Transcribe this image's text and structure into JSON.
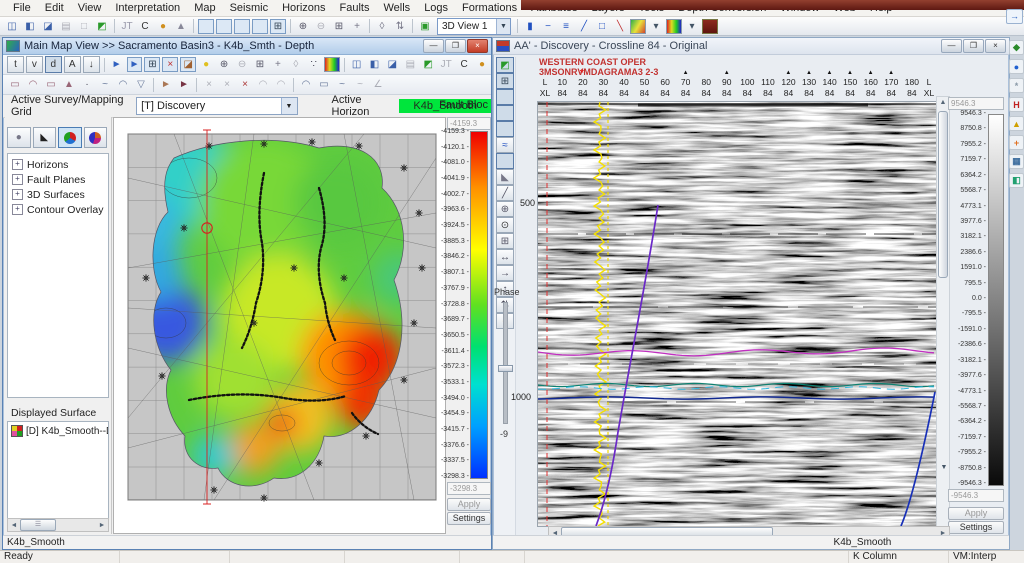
{
  "menu": {
    "items": [
      "File",
      "Edit",
      "View",
      "Interpretation",
      "Map",
      "Seismic",
      "Horizons",
      "Faults",
      "Wells",
      "Logs",
      "Formations",
      "Attributes",
      "Layers",
      "Tools",
      "Depth Conversion",
      "Window",
      "Web",
      "Help"
    ]
  },
  "main_toolbar": {
    "view_selector": "3D View 1",
    "icons": [
      {
        "n": "split-vertical-icon",
        "g": "◫",
        "c": "#3a5fa8"
      },
      {
        "n": "split-horizontal-icon",
        "g": "◧",
        "c": "#3a5fa8"
      },
      {
        "n": "new-window-icon",
        "g": "◪",
        "c": "#3a5fa8"
      },
      {
        "n": "window-gray-icon",
        "g": "▤",
        "d": true
      },
      {
        "n": "window-small-icon",
        "g": "□",
        "d": true
      },
      {
        "n": "map-window-icon",
        "g": "◩",
        "c": "#2a9a2a"
      },
      {
        "s": true
      },
      {
        "n": "jt-button",
        "g": "JT",
        "c": "#99a"
      },
      {
        "n": "c-button",
        "g": "C",
        "c": "#333"
      },
      {
        "n": "well-tools-icon",
        "g": "●",
        "c": "#d09020"
      },
      {
        "n": "flask-icon",
        "g": "▲",
        "c": "#889"
      },
      {
        "s": true
      },
      {
        "n": "inline-view-icon",
        "b": "redblue",
        "p": true
      },
      {
        "n": "crossline-view-icon",
        "b": "redblue",
        "p": true
      },
      {
        "n": "timeslice-view-icon",
        "b": "redblue",
        "p": true
      },
      {
        "n": "arbitrary-line-view-icon",
        "b": "redblue",
        "p": true
      },
      {
        "n": "grid-view-icon",
        "g": "⊞",
        "p": true,
        "c": "#345"
      },
      {
        "s": true
      },
      {
        "n": "zoom-in-icon",
        "g": "⊕",
        "c": "#556"
      },
      {
        "n": "zoom-out-icon",
        "g": "⊖",
        "d": true
      },
      {
        "n": "zoom-extent-icon",
        "g": "⊞",
        "c": "#556"
      },
      {
        "n": "pan-icon",
        "g": "+",
        "c": "#778"
      },
      {
        "s": true
      },
      {
        "n": "lock-icon",
        "g": "◊",
        "c": "#778"
      },
      {
        "n": "sync-scroll-icon",
        "g": "⇅",
        "c": "#778"
      },
      {
        "s": true
      },
      {
        "n": "refresh-view-icon",
        "g": "▣",
        "c": "#2a9a2a"
      },
      {
        "combo": true
      },
      {
        "s": true
      },
      {
        "n": "wiggle-display-icon",
        "g": "▮",
        "c": "#2050c0"
      },
      {
        "n": "line-tool-icon",
        "g": "−",
        "c": "#2050c0"
      },
      {
        "n": "multiline-tool-icon",
        "g": "≡",
        "c": "#2050c0"
      },
      {
        "n": "slope-tool-icon",
        "g": "╱",
        "c": "#2050c0"
      },
      {
        "n": "rectangle-tool-icon",
        "g": "□",
        "c": "#2050c0"
      },
      {
        "n": "fault-segment-tool-icon",
        "g": "╲",
        "c": "#c03030"
      },
      {
        "n": "colormap-icon",
        "b": "map"
      },
      {
        "n": "caret-colormap-icon",
        "g": "▾",
        "c": "#456"
      },
      {
        "n": "palette-icon",
        "b": "palette"
      },
      {
        "n": "caret-palette-icon",
        "g": "▾",
        "c": "#456"
      },
      {
        "n": "maroon-display-icon",
        "b": "maroon"
      }
    ]
  },
  "map_window": {
    "title": "Main Map View >> Sacramento Basin3 - K4b_Smth - Depth",
    "mode_buttons": [
      "t",
      "v",
      "d",
      "A",
      "↓"
    ],
    "toolbar_icons": [
      {
        "n": "select-arrow-icon",
        "g": "►",
        "c": "#3060c0"
      },
      {
        "n": "select-wave-icon",
        "g": "►",
        "c": "#3060c0",
        "p": true
      },
      {
        "n": "grid-select-icon",
        "g": "⊞",
        "c": "#345",
        "p": true
      },
      {
        "n": "delete-grid-icon",
        "g": "×",
        "c": "#c03030",
        "p": true
      },
      {
        "n": "eraser-icon",
        "g": "◪",
        "c": "#a06030",
        "p": true
      },
      {
        "n": "bubble-icon",
        "g": "●",
        "c": "#e0c020"
      },
      {
        "n": "zoom-in-icon",
        "g": "⊕",
        "c": "#556"
      },
      {
        "n": "zoom-out-icon",
        "g": "⊖",
        "d": true
      },
      {
        "n": "zoom-grid-icon",
        "g": "⊞",
        "c": "#556"
      },
      {
        "n": "pan-icon",
        "g": "+",
        "c": "#778"
      },
      {
        "n": "undo-icon",
        "g": "◊",
        "d": true
      },
      {
        "n": "posting-icon",
        "g": "∵",
        "c": "#445"
      },
      {
        "n": "tricolor-map-icon",
        "b": "palette"
      },
      {
        "s": true
      },
      {
        "n": "split-vertical-icon",
        "g": "◫",
        "c": "#3a5fa8"
      },
      {
        "n": "split-horizontal-icon",
        "g": "◧",
        "c": "#3a5fa8"
      },
      {
        "n": "new-window-icon",
        "g": "◪",
        "c": "#3a5fa8"
      },
      {
        "n": "window-gray-icon",
        "g": "▤",
        "d": true
      },
      {
        "n": "map-window-icon",
        "g": "◩",
        "c": "#2a9a2a"
      },
      {
        "n": "jt-button",
        "g": "JT",
        "d": true
      },
      {
        "n": "c-button",
        "g": "C",
        "c": "#333"
      },
      {
        "n": "well-tools-icon",
        "g": "●",
        "c": "#d09020"
      }
    ],
    "edit_toolbar_icons": [
      {
        "n": "contour-rect-icon",
        "g": "▭",
        "c": "#967"
      },
      {
        "n": "contour-arc-icon",
        "g": "◠",
        "c": "#967"
      },
      {
        "n": "contour-flat-icon",
        "g": "▭",
        "c": "#967"
      },
      {
        "n": "peak-pick-icon",
        "g": "▲",
        "c": "#967"
      },
      {
        "n": "point-pick-icon",
        "g": "·",
        "c": "#445"
      },
      {
        "n": "smooth-pick-icon",
        "g": "~",
        "c": "#679"
      },
      {
        "n": "arc-pick-icon",
        "g": "◠",
        "c": "#679"
      },
      {
        "n": "trough-pick-icon",
        "g": "▽",
        "c": "#679"
      },
      {
        "s": true
      },
      {
        "n": "snap-right-icon",
        "g": "►",
        "c": "#a75"
      },
      {
        "n": "snap-strong-icon",
        "g": "►",
        "c": "#734"
      },
      {
        "s": true
      },
      {
        "n": "erase-pick-icon",
        "g": "×",
        "d": true
      },
      {
        "n": "erase-area-icon",
        "g": "×",
        "d": true
      },
      {
        "n": "erase-all-icon",
        "g": "×",
        "c": "#a33"
      },
      {
        "n": "interp-arc-icon",
        "g": "◠",
        "d": true
      },
      {
        "n": "interp-arc2-icon",
        "g": "◠",
        "d": true
      },
      {
        "s": true
      },
      {
        "n": "extend-arc-icon",
        "g": "◠",
        "c": "#679"
      },
      {
        "n": "extend-flat-icon",
        "g": "▭",
        "c": "#679"
      },
      {
        "n": "wave-smooth-icon",
        "g": "~",
        "c": "#679"
      },
      {
        "n": "wave-smooth2-icon",
        "g": "~",
        "d": true
      },
      {
        "n": "angle-pick-icon",
        "g": "∠",
        "d": true
      }
    ],
    "controls": {
      "survey_label": "Active Survey/Mapping Grid",
      "survey_value": "[T] Discovery",
      "horizon_label": "Active Horizon",
      "horizon_value": "K4b_Smooth",
      "fault_label": "Fault Bloc"
    },
    "tree_items": [
      "Horizons",
      "Fault Planes",
      "3D Surfaces",
      "Contour Overlay"
    ],
    "displayed_surface": {
      "label": "Displayed Surface",
      "item": "[D] K4b_Smooth--Di..."
    },
    "colorbar": {
      "max_value": "-4159.3",
      "min_value": "-3298.3",
      "apply_label": "Apply",
      "settings_label": "Settings",
      "ticks": [
        "-4159.3",
        "-4120.1",
        "-4081.0",
        "-4041.9",
        "-4002.7",
        "-3963.6",
        "-3924.5",
        "-3885.3",
        "-3846.2",
        "-3807.1",
        "-3767.9",
        "-3728.8",
        "-3689.7",
        "-3650.5",
        "-3611.4",
        "-3572.3",
        "-3533.1",
        "-3494.0",
        "-3454.9",
        "-3415.7",
        "-3376.6",
        "-3337.5",
        "-3298.3"
      ]
    },
    "status": "K4b_Smooth"
  },
  "seismic_window": {
    "title": "AA' - Discovery - Crossline 84 - Original",
    "annotations": [
      "WESTERN COAST OPER",
      "3MSONRVMDAGRAMA3 2-3"
    ],
    "axis": {
      "left_line_label": "L",
      "left_xl_label": "XL",
      "right_line_label": "L",
      "right_xl_label": "XL",
      "line_numbers": [
        "10",
        "20",
        "30",
        "40",
        "50",
        "60",
        "70",
        "80",
        "90",
        "100",
        "110",
        "120",
        "130",
        "140",
        "150",
        "160",
        "170",
        "180"
      ],
      "crossline_value": "84",
      "well_marker_lines": [
        "70",
        "90",
        "120",
        "130",
        "140",
        "150",
        "160",
        "170"
      ],
      "cursor_line": "20"
    },
    "side_icons": [
      {
        "n": "display-mode-icon",
        "g": "◩",
        "c": "#2a9a2a",
        "p": true
      },
      {
        "n": "fit-section-icon",
        "g": "⊞",
        "c": "#345",
        "p": true
      },
      {
        "n": "wiggle-va-icon",
        "b": "redblue",
        "p": true
      },
      {
        "n": "density-display-icon",
        "b": "redblue",
        "p": true
      },
      {
        "n": "dual-display-icon",
        "b": "redblue",
        "p": true
      },
      {
        "n": "interpolate-icon",
        "g": "≈",
        "c": "#2050c0"
      },
      {
        "n": "colorbar-icon",
        "b": "vgrad",
        "p": true
      },
      {
        "n": "scale-wedge-icon",
        "g": "◣",
        "c": "#778"
      },
      {
        "n": "pick-slope-icon",
        "g": "╱",
        "c": "#556"
      },
      {
        "n": "zoom-in-icon",
        "g": "⊕",
        "c": "#556"
      },
      {
        "n": "zoom-out-icon",
        "g": "⊙",
        "d": true
      },
      {
        "n": "zoom-extent-icon",
        "g": "⊞",
        "c": "#556"
      },
      {
        "n": "stretch-horizontal-icon",
        "g": "↔",
        "c": "#445"
      },
      {
        "n": "shift-right-icon",
        "g": "→",
        "c": "#445"
      },
      {
        "n": "stretch-vertical-icon",
        "g": "↕",
        "c": "#445"
      },
      {
        "n": "swap-vertical-icon",
        "g": "⇅",
        "c": "#445"
      },
      {
        "n": "trackball-icon",
        "g": "●",
        "c": "#d09020"
      }
    ],
    "phase": {
      "label": "Phase",
      "value": "-9"
    },
    "time_labels": [
      "500",
      "1000"
    ],
    "colorbar": {
      "max_value": "9546.3",
      "min_value": "-9546.3",
      "apply_label": "Apply",
      "settings_label": "Settings",
      "ticks": [
        "9546.3",
        "8750.8",
        "7955.2",
        "7159.7",
        "6364.2",
        "5568.7",
        "4773.1",
        "3977.6",
        "3182.1",
        "2386.6",
        "1591.0",
        "795.5",
        "0.0",
        "-795.5",
        "-1591.0",
        "-2386.6",
        "-3182.1",
        "-3977.6",
        "-4773.1",
        "-5568.7",
        "-6364.2",
        "-7159.7",
        "-7955.2",
        "-8750.8",
        "-9546.3"
      ]
    },
    "status": "K4b_Smooth"
  },
  "dock_icons": [
    {
      "n": "session-icon",
      "g": "◆",
      "c": "#2a8a2a"
    },
    {
      "n": "globe-icon",
      "g": "●",
      "c": "#2060d0"
    },
    {
      "n": "snowflake-icon",
      "g": "*",
      "c": "#8a9aa8"
    },
    {
      "n": "wells-module-icon",
      "g": "H",
      "c": "#c02020"
    },
    {
      "n": "warning-icon",
      "g": "▲",
      "c": "#d0a000"
    },
    {
      "n": "add-module-icon",
      "g": "+",
      "c": "#e07020"
    },
    {
      "n": "grid-module-icon",
      "g": "▦",
      "c": "#4070a0"
    },
    {
      "n": "layers-module-icon",
      "g": "◧",
      "c": "#20a070"
    }
  ],
  "statusbar": {
    "ready": "Ready",
    "k_column": "K Column",
    "vm": "VM:Interp"
  }
}
